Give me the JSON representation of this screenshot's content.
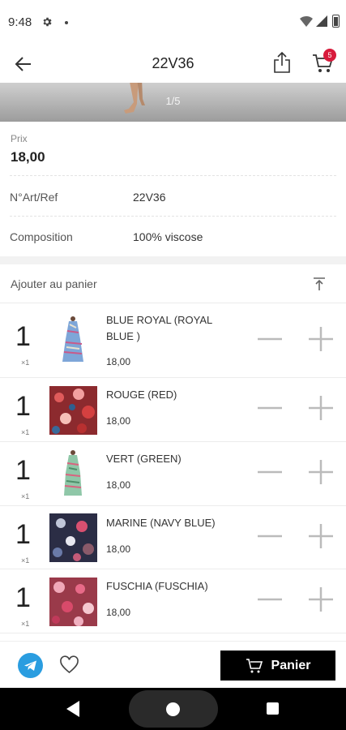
{
  "status_bar": {
    "time": "9:48"
  },
  "app_bar": {
    "title": "22V36",
    "cart_badge": "5"
  },
  "gallery": {
    "counter": "1/5"
  },
  "details": {
    "price_label": "Prix",
    "price_value": "18,00",
    "rows": [
      {
        "label": "N°Art/Ref",
        "value": "22V36"
      },
      {
        "label": "Composition",
        "value": "100% viscose"
      }
    ]
  },
  "add_to_cart": {
    "label": "Ajouter au panier",
    "variants": [
      {
        "qty": "1",
        "mult": "×1",
        "name": "BLUE ROYAL (ROYAL BLUE )",
        "price": "18,00"
      },
      {
        "qty": "1",
        "mult": "×1",
        "name": "ROUGE (RED)",
        "price": "18,00"
      },
      {
        "qty": "1",
        "mult": "×1",
        "name": "VERT (GREEN)",
        "price": "18,00"
      },
      {
        "qty": "1",
        "mult": "×1",
        "name": "MARINE (NAVY BLUE)",
        "price": "18,00"
      },
      {
        "qty": "1",
        "mult": "×1",
        "name": "FUSCHIA (FUSCHIA)",
        "price": "18,00"
      }
    ]
  },
  "bottom_bar": {
    "panier_label": "Panier"
  },
  "colors": {
    "badge": "#d81b3c",
    "telegram": "#2a9de0",
    "primary_button": "#000000"
  }
}
